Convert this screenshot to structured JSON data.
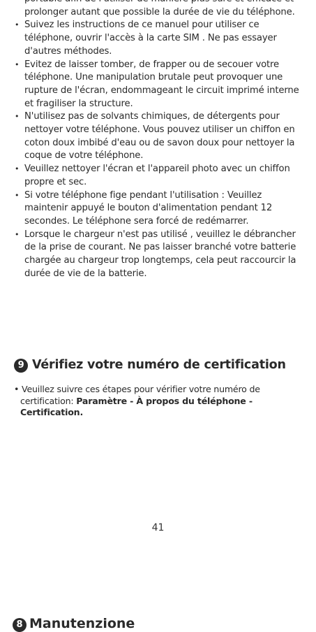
{
  "bullets": {
    "continuation": "portable afin de l'utiliser de manière plus sûre et efficace et prolonger autant que possible la durée de vie du téléphone.",
    "items": [
      "Suivez les instructions de ce manuel pour utiliser ce téléphone, ouvrir l'accès  à la carte SIM . Ne pas essayer d'autres méthodes.",
      "Evitez de laisser tomber, de frapper ou de secouer votre téléphone.  Une manipulation brutale peut provoquer une rupture de l'écran, endommageant le circuit imprimé interne et fragiliser la structure.",
      "N'utilisez pas de solvants chimiques, de détergents pour nettoyer votre téléphone.  Vous pouvez utiliser un chiffon en coton doux imbibé d'eau ou de savon doux pour nettoyer la coque de votre téléphone.",
      "Veuillez nettoyer l'écran et l'appareil photo avec un chiffon propre et sec.",
      "Si votre téléphone fige pendant l'utilisation :  Veuillez maintenir appuyé le bouton d'alimentation pendant 12 secondes. Le téléphone sera forcé de redémarrer.",
      "Lorsque le chargeur n'est pas utilisé , veuillez le débrancher de la prise de courant. Ne pas laisser branché votre batterie chargée au chargeur trop longtemps, cela peut raccourcir la durée de vie de la batterie."
    ]
  },
  "certification": {
    "number": "9",
    "title": "Vérifiez votre numéro de certification",
    "text": "• Veuillez suivre ces étapes pour vérifier votre numéro de certification: ",
    "path": "Paramètre - À propos du téléphone - Certification."
  },
  "page_number": "41",
  "next_section": {
    "number": "8",
    "title": "Manutenzione"
  }
}
